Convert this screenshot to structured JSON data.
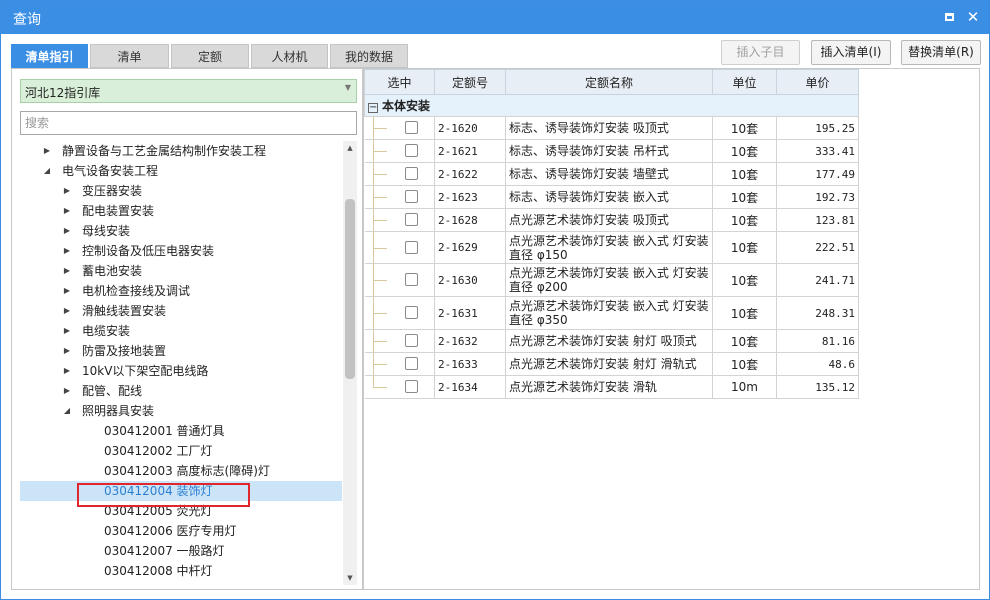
{
  "window": {
    "title": "查询"
  },
  "tabs": [
    {
      "label": "清单指引",
      "active": true
    },
    {
      "label": "清单",
      "active": false
    },
    {
      "label": "定额",
      "active": false
    },
    {
      "label": "人材机",
      "active": false
    },
    {
      "label": "我的数据",
      "active": false
    }
  ],
  "actions": {
    "insert_child": "插入子目",
    "insert_list": "插入清单(I)",
    "replace_list": "替换清单(R)"
  },
  "library": {
    "selected": "河北12指引库"
  },
  "search": {
    "placeholder": "搜索"
  },
  "tree": [
    {
      "label": "静置设备与工艺金属结构制作安装工程",
      "level": 1,
      "arrow": "▶"
    },
    {
      "label": "电气设备安装工程",
      "level": 1,
      "arrow": "◢"
    },
    {
      "label": "变压器安装",
      "level": 2,
      "arrow": "▶"
    },
    {
      "label": "配电装置安装",
      "level": 2,
      "arrow": "▶"
    },
    {
      "label": "母线安装",
      "level": 2,
      "arrow": "▶"
    },
    {
      "label": "控制设备及低压电器安装",
      "level": 2,
      "arrow": "▶"
    },
    {
      "label": "蓄电池安装",
      "level": 2,
      "arrow": "▶"
    },
    {
      "label": "电机检查接线及调试",
      "level": 2,
      "arrow": "▶"
    },
    {
      "label": "滑触线装置安装",
      "level": 2,
      "arrow": "▶"
    },
    {
      "label": "电缆安装",
      "level": 2,
      "arrow": "▶"
    },
    {
      "label": "防雷及接地装置",
      "level": 2,
      "arrow": "▶"
    },
    {
      "label": "10kV以下架空配电线路",
      "level": 2,
      "arrow": "▶"
    },
    {
      "label": "配管、配线",
      "level": 2,
      "arrow": "▶"
    },
    {
      "label": "照明器具安装",
      "level": 2,
      "arrow": "◢"
    },
    {
      "label": "030412001  普通灯具",
      "level": 3,
      "arrow": ""
    },
    {
      "label": "030412002  工厂灯",
      "level": 3,
      "arrow": ""
    },
    {
      "label": "030412003  高度标志(障碍)灯",
      "level": 3,
      "arrow": ""
    },
    {
      "label": "030412004  装饰灯",
      "level": 3,
      "arrow": "",
      "selected": true
    },
    {
      "label": "030412005  荧光灯",
      "level": 3,
      "arrow": ""
    },
    {
      "label": "030412006  医疗专用灯",
      "level": 3,
      "arrow": ""
    },
    {
      "label": "030412007  一般路灯",
      "level": 3,
      "arrow": ""
    },
    {
      "label": "030412008  中杆灯",
      "level": 3,
      "arrow": ""
    }
  ],
  "table": {
    "headers": [
      "选中",
      "定额号",
      "定额名称",
      "单位",
      "单价"
    ],
    "group": {
      "toggle": "−",
      "label": "本体安装"
    },
    "rows": [
      {
        "code": "2-1620",
        "name": "标志、诱导装饰灯安装 吸顶式",
        "unit": "10套",
        "price": "195.25"
      },
      {
        "code": "2-1621",
        "name": "标志、诱导装饰灯安装 吊杆式",
        "unit": "10套",
        "price": "333.41"
      },
      {
        "code": "2-1622",
        "name": "标志、诱导装饰灯安装 墙壁式",
        "unit": "10套",
        "price": "177.49"
      },
      {
        "code": "2-1623",
        "name": "标志、诱导装饰灯安装 嵌入式",
        "unit": "10套",
        "price": "192.73"
      },
      {
        "code": "2-1628",
        "name": "点光源艺术装饰灯安装 吸顶式",
        "unit": "10套",
        "price": "123.81"
      },
      {
        "code": "2-1629",
        "name": "点光源艺术装饰灯安装 嵌入式 灯安装直径 φ150",
        "unit": "10套",
        "price": "222.51"
      },
      {
        "code": "2-1630",
        "name": "点光源艺术装饰灯安装 嵌入式 灯安装直径 φ200",
        "unit": "10套",
        "price": "241.71"
      },
      {
        "code": "2-1631",
        "name": "点光源艺术装饰灯安装 嵌入式 灯安装直径 φ350",
        "unit": "10套",
        "price": "248.31"
      },
      {
        "code": "2-1632",
        "name": "点光源艺术装饰灯安装 射灯 吸顶式",
        "unit": "10套",
        "price": "81.16"
      },
      {
        "code": "2-1633",
        "name": "点光源艺术装饰灯安装 射灯 滑轨式",
        "unit": "10套",
        "price": "48.6"
      },
      {
        "code": "2-1634",
        "name": "点光源艺术装饰灯安装 滑轨",
        "unit": "10m",
        "price": "135.12"
      }
    ]
  }
}
